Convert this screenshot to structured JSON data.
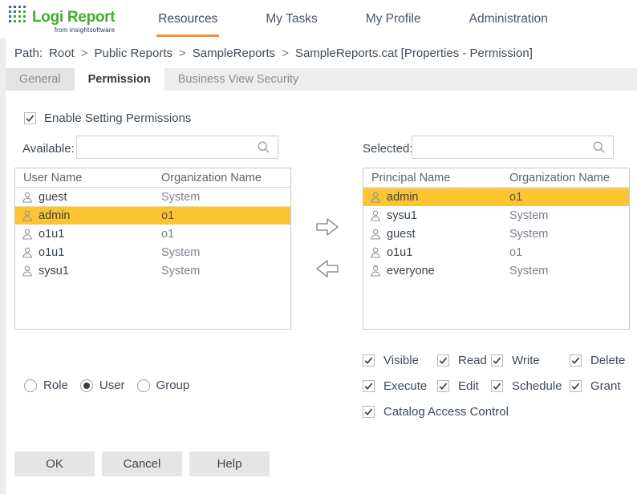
{
  "colors": {
    "highlight_yellow": "#fdc431",
    "accent_orange": "#ef8f3c",
    "logo_green": "#3fae2a",
    "logo_navy": "#17375e"
  },
  "header": {
    "logo_title": "Logi Report",
    "logo_subtitle": "from insightsoftware",
    "nav": [
      {
        "label": "Resources",
        "active": true
      },
      {
        "label": "My Tasks",
        "active": false
      },
      {
        "label": "My Profile",
        "active": false
      },
      {
        "label": "Administration",
        "active": false
      }
    ]
  },
  "path": {
    "prefix": "Path:",
    "separator": ">",
    "segments": [
      "Root",
      "Public Reports",
      "SampleReports",
      "SampleReports.cat [Properties - Permission]"
    ]
  },
  "tabs": [
    {
      "label": "General",
      "active": false
    },
    {
      "label": "Permission",
      "active": true
    },
    {
      "label": "Business View Security",
      "active": false
    }
  ],
  "permission_panel": {
    "enable": {
      "label": "Enable Setting Permissions",
      "checked": true
    },
    "available": {
      "label": "Available:",
      "search_value": "",
      "columns": [
        "User Name",
        "Organization Name"
      ],
      "rows": [
        {
          "name": "guest",
          "org": "System",
          "icon": "user",
          "selected": false
        },
        {
          "name": "admin",
          "org": "o1",
          "icon": "user",
          "selected": true
        },
        {
          "name": "o1u1",
          "org": "o1",
          "icon": "user",
          "selected": false
        },
        {
          "name": "o1u1",
          "org": "System",
          "icon": "user",
          "selected": false
        },
        {
          "name": "sysu1",
          "org": "System",
          "icon": "user",
          "selected": false
        }
      ]
    },
    "selected": {
      "label": "Selected:",
      "search_value": "",
      "columns": [
        "Principal Name",
        "Organization Name"
      ],
      "rows": [
        {
          "name": "admin",
          "org": "o1",
          "icon": "user",
          "selected": true
        },
        {
          "name": "sysu1",
          "org": "System",
          "icon": "user",
          "selected": false
        },
        {
          "name": "guest",
          "org": "System",
          "icon": "user",
          "selected": false
        },
        {
          "name": "o1u1",
          "org": "o1",
          "icon": "user",
          "selected": false
        },
        {
          "name": "everyone",
          "org": "System",
          "icon": "everyone",
          "selected": false
        }
      ]
    },
    "rights": [
      [
        {
          "label": "Visible",
          "checked": true
        },
        {
          "label": "Read",
          "checked": true
        },
        {
          "label": "Write",
          "checked": true
        },
        {
          "label": "Delete",
          "checked": true
        }
      ],
      [
        {
          "label": "Execute",
          "checked": true
        },
        {
          "label": "Edit",
          "checked": true
        },
        {
          "label": "Schedule",
          "checked": true
        },
        {
          "label": "Grant",
          "checked": true
        }
      ],
      [
        {
          "label": "Catalog Access Control",
          "checked": true
        }
      ]
    ],
    "principal_type": [
      {
        "label": "Role",
        "selected": false
      },
      {
        "label": "User",
        "selected": true
      },
      {
        "label": "Group",
        "selected": false
      }
    ],
    "actions": [
      {
        "label": "OK"
      },
      {
        "label": "Cancel"
      },
      {
        "label": "Help"
      }
    ]
  }
}
